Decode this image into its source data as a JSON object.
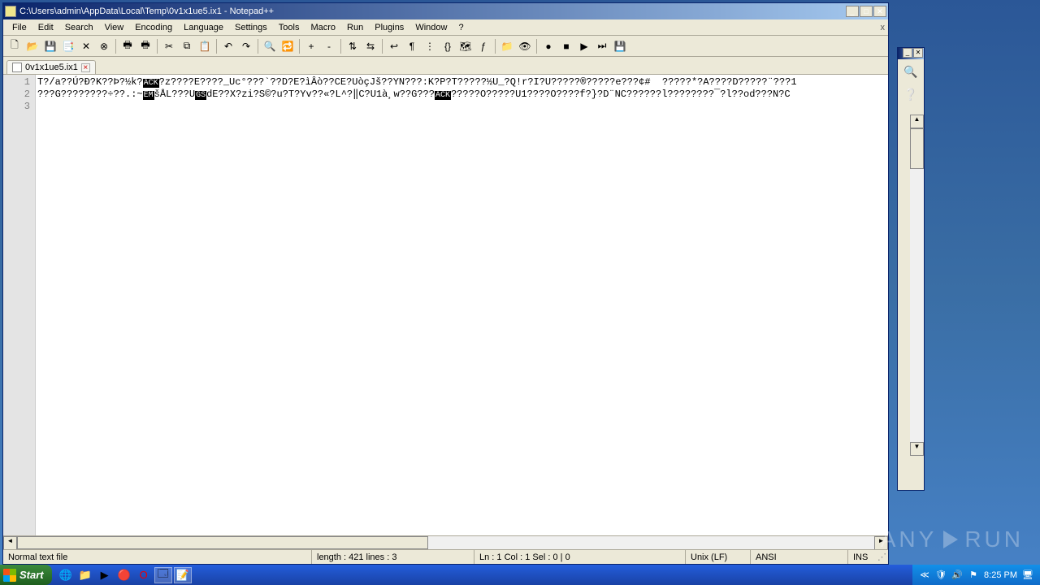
{
  "window": {
    "title": "C:\\Users\\admin\\AppData\\Local\\Temp\\0v1x1ue5.ix1 - Notepad++"
  },
  "menu": [
    "File",
    "Edit",
    "Search",
    "View",
    "Encoding",
    "Language",
    "Settings",
    "Tools",
    "Macro",
    "Run",
    "Plugins",
    "Window",
    "?"
  ],
  "toolbar_icons": [
    "new-file-icon",
    "open-file-icon",
    "save-icon",
    "save-all-icon",
    "close-icon",
    "close-all-icon",
    "print-icon",
    "print-now-icon",
    "cut-icon",
    "copy-icon",
    "paste-icon",
    "undo-icon",
    "redo-icon",
    "find-icon",
    "replace-icon",
    "zoom-in-icon",
    "zoom-out-icon",
    "sync-v-icon",
    "sync-h-icon",
    "wrap-icon",
    "all-chars-icon",
    "indent-guide-icon",
    "udl-icon",
    "doc-map-icon",
    "func-list-icon",
    "folder-icon",
    "monitor-icon",
    "record-icon",
    "stop-icon",
    "play-icon",
    "play-multi-icon",
    "save-macro-icon"
  ],
  "toolbar_glyphs": [
    "🗋",
    "📂",
    "💾",
    "📑",
    "✕",
    "⊗",
    "🖶",
    "🖶",
    "✂",
    "⧉",
    "📋",
    "↶",
    "↷",
    "🔍",
    "🔁",
    "+",
    "-",
    "⇅",
    "⇆",
    "↩",
    "¶",
    "⋮",
    "{}",
    "🗺",
    "ƒ",
    "📁",
    "👁",
    "●",
    "■",
    "▶",
    "⏭",
    "💾"
  ],
  "tab": {
    "name": "0v1x1ue5.ix1"
  },
  "editor": {
    "line_numbers": [
      "1",
      "2",
      "3"
    ],
    "lines": [
      "T?/a??Ú?Đ?K??Þ?½k?<ACK>?z????E????_Uc°???`??D?E?ìÂò??CE?UòçJš??YN???:K?P?T?????½U_?Q!r?I?U?????®?????e???¢#  ?????*?A????D?????¨???1",
      "???G????????÷??.:~<EM>šÅL???U<GS>dE??X?zi?S©?u?T?Yv??«?L^?‖C?U1à¸w??G???<ACK>?????O?????U1????O????f?}?D¨NC??????l????????¯?l??od???N?C",
      ""
    ]
  },
  "status": {
    "filetype": "Normal text file",
    "length": "length : 421    lines : 3",
    "position": "Ln : 1    Col : 1    Sel : 0 | 0",
    "eol": "Unix (LF)",
    "encoding": "ANSI",
    "mode": "INS"
  },
  "taskbar": {
    "start": "Start",
    "time": "8:25 PM"
  },
  "watermark": {
    "left": "ANY",
    "right": "RUN"
  }
}
